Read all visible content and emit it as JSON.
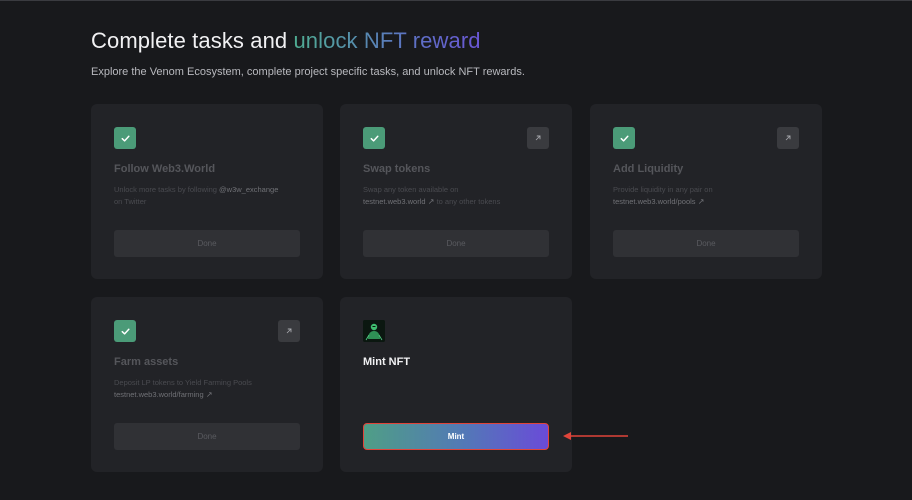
{
  "header": {
    "title_plain": "Complete tasks and ",
    "title_highlight": "unlock NFT reward",
    "subtitle": "Explore the Venom Ecosystem, complete project specific tasks, and unlock NFT rewards."
  },
  "tasks": [
    {
      "title": "Follow Web3.World",
      "desc_before": "Unlock more tasks by following ",
      "desc_link": "@w3w_exchange",
      "desc_after": " on Twitter",
      "button": "Done",
      "completed": true,
      "icon": "check-icon"
    },
    {
      "title": "Swap tokens",
      "desc_before": "Swap any token available on",
      "desc_link": "testnet.web3.world",
      "desc_after": " to any other tokens",
      "button": "Done",
      "completed": true,
      "icon": "check-icon",
      "external_icon": "arrow-up-right-icon"
    },
    {
      "title": "Add Liquidity",
      "desc_before": "Provide liquidity in any pair on",
      "desc_link": "testnet.web3.world/pools",
      "button": "Done",
      "completed": true,
      "icon": "check-icon",
      "external_icon": "arrow-up-right-icon"
    },
    {
      "title": "Farm assets",
      "desc_before": "Deposit LP tokens to Yield Farming Pools",
      "desc_link": "testnet.web3.world/farming",
      "button": "Done",
      "completed": true,
      "icon": "check-icon",
      "external_icon": "arrow-up-right-icon"
    }
  ],
  "mint": {
    "title": "Mint NFT",
    "button": "Mint",
    "icon": "nft-avatar-icon"
  },
  "colors": {
    "background": "#18191c",
    "card": "#222327",
    "check": "#4b9b78",
    "gradient_start": "#4f9e86",
    "gradient_end": "#6a4bd8",
    "annotation_red": "#e0443a"
  }
}
